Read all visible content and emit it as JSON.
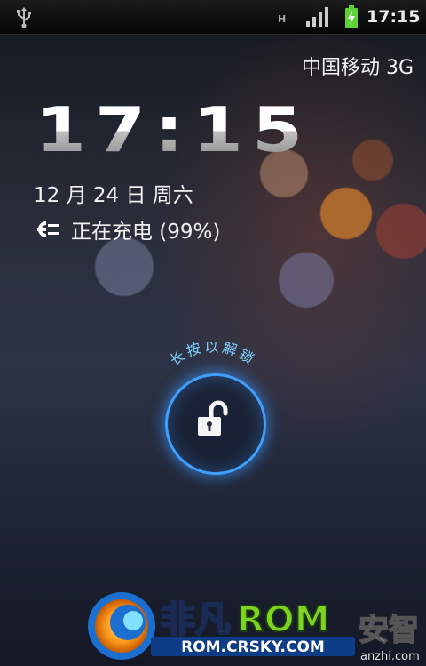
{
  "status_bar": {
    "network_type": "H",
    "time": "17:15"
  },
  "carrier": "中国移动 3G",
  "clock": "17:15",
  "date": "12 月 24 日 周六",
  "charging": "正在充电 (99%)",
  "unlock_hint": "长按以解锁",
  "brand": {
    "name": "非凡ROM",
    "site": "ROM.CRSKY.COM"
  },
  "watermark": {
    "name": "安智",
    "site": "anzhi.com"
  },
  "colors": {
    "accent_blue": "#3fa0ff",
    "battery_green": "#5fd13a",
    "rom_green": "#7ed321"
  },
  "icons": [
    "usb-icon",
    "signal-icon",
    "battery-charging-icon",
    "plug-icon",
    "unlock-icon"
  ]
}
